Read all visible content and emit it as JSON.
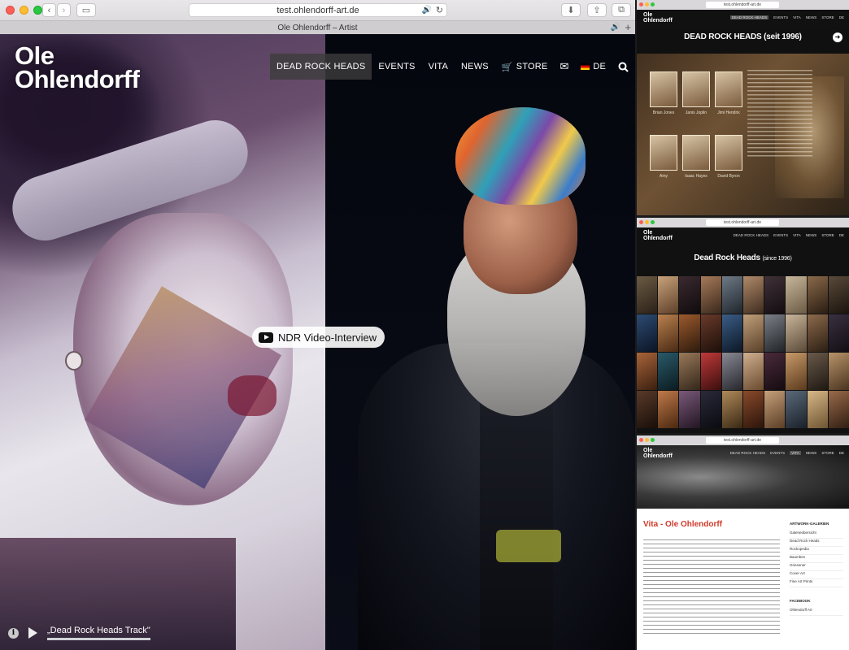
{
  "browser": {
    "url": "test.ohlendorff-art.de",
    "tab_title": "Ole Ohlendorff – Artist"
  },
  "site": {
    "logo_line1": "Ole",
    "logo_line2": "Ohlendorff",
    "nav": [
      {
        "label": "DEAD ROCK HEADS",
        "active": true
      },
      {
        "label": "EVENTS",
        "active": false
      },
      {
        "label": "VITA",
        "active": false
      },
      {
        "label": "NEWS",
        "active": false
      },
      {
        "label": "STORE",
        "active": false
      }
    ],
    "lang": "DE",
    "video_button": "NDR Video-Interview",
    "track_label": "„Dead Rock Heads Track\""
  },
  "thumbnails": {
    "t1": {
      "url": "test.ohlendorff-art.de",
      "logo_line1": "Ole",
      "logo_line2": "Ohlendorff",
      "title": "DEAD ROCK HEADS (seit 1996)",
      "portrait_names": [
        "Brian Jones",
        "Janis Joplin",
        "Jimi Hendrix",
        "Amy",
        "Isaac Hayes",
        "David Byron"
      ]
    },
    "t2": {
      "url": "test.ohlendorff-art.de",
      "logo_line1": "Ole",
      "logo_line2": "Ohlendorff",
      "title_main": "Dead Rock Heads",
      "title_sub": "(since 1996)"
    },
    "t3": {
      "url": "test.ohlendorff-art.de",
      "logo_line1": "Ole",
      "logo_line2": "Ohlendorff",
      "title": "Vita - Ole Ohlendorff",
      "sidebar_heading": "ARTWORK-GALERIEN",
      "sidebar_items": [
        "Galerieübersicht",
        "Dead Rock Heads",
        "Rockopedia",
        "Baumbes",
        "Griesener",
        "Cover Art",
        "Fine Art Prints"
      ],
      "facebook_heading": "FACEBOOK",
      "facebook_name": "Ohlendorff Art"
    },
    "mini_nav": [
      "DEAD ROCK HEADS",
      "EVENTS",
      "VITA",
      "NEWS",
      "STORE",
      "DE"
    ]
  },
  "colors": {
    "nav_active_bg": "#3c3c3c",
    "accent_red": "#d23a2b"
  }
}
